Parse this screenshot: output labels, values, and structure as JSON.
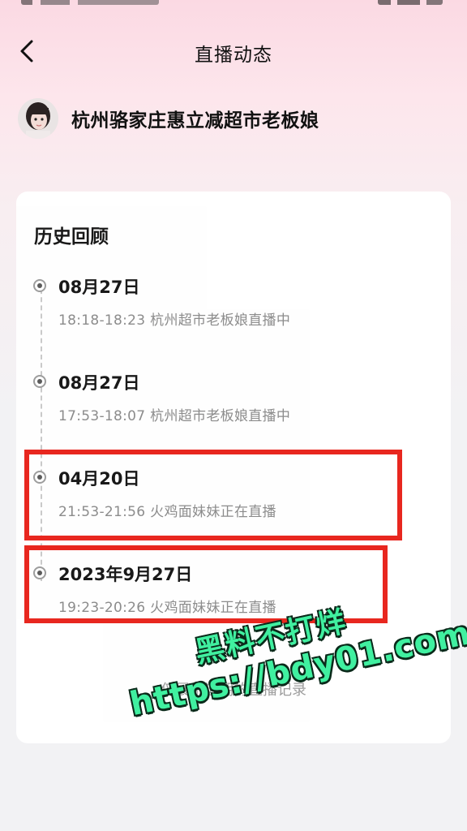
{
  "header": {
    "title": "直播动态",
    "back_icon": "chevron-left-icon"
  },
  "profile": {
    "name": "杭州骆家庄惠立减超市老板娘"
  },
  "history": {
    "title": "历史回顾",
    "entries": [
      {
        "date": "08月27日",
        "time": "18:18-18:23",
        "title": "杭州超市老板娘直播中"
      },
      {
        "date": "08月27日",
        "time": "17:53-18:07",
        "title": "杭州超市老板娘直播中"
      },
      {
        "date": "04月20日",
        "time": "21:53-21:56",
        "title": "火鸡面妹妹正在直播"
      },
      {
        "date": "2023年9月27日",
        "time": "19:23-20:26",
        "title": "火鸡面妹妹正在直播"
      }
    ],
    "footer_note": "仅展示近期的直播记录"
  },
  "watermark": {
    "line1": "黑料不打烊",
    "line2": "https://bdy01.com"
  },
  "colors": {
    "highlight": "#e8271f",
    "watermark": "#40f0a0"
  }
}
